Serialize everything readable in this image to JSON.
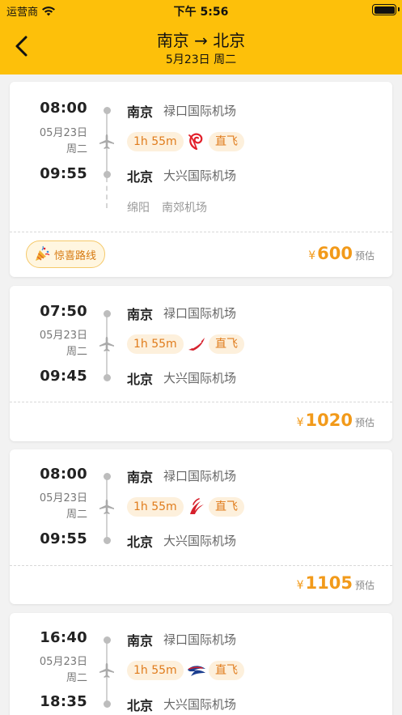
{
  "status": {
    "carrier": "运营商",
    "time": "下午 5:56"
  },
  "header": {
    "title": "南京 → 北京",
    "subtitle": "5月23日 周二"
  },
  "colors": {
    "brand": "#fdc00a",
    "accent": "#f29a1a",
    "chip_bg": "#fdf0dc"
  },
  "icons": [
    "wifi-icon",
    "battery-icon",
    "back-arrow-icon",
    "plane-icon",
    "airline-logo-icon",
    "party-popper-icon"
  ],
  "flights": [
    {
      "dep_time": "08:00",
      "date": "05月23日",
      "weekday": "周二",
      "arr_time": "09:55",
      "dep_city": "南京",
      "dep_airport": "禄口国际机场",
      "arr_city": "北京",
      "arr_airport": "大兴国际机场",
      "duration": "1h 55m",
      "airline_logo": "air-china",
      "direct": "直飞",
      "stop_city": "绵阳",
      "stop_airport": "南郊机场",
      "promo": "惊喜路线",
      "yen": "¥",
      "price": "600",
      "est": "预估"
    },
    {
      "dep_time": "07:50",
      "date": "05月23日",
      "weekday": "周二",
      "arr_time": "09:45",
      "dep_city": "南京",
      "dep_airport": "禄口国际机场",
      "arr_city": "北京",
      "arr_airport": "大兴国际机场",
      "duration": "1h 55m",
      "airline_logo": "sichuan-airlines",
      "direct": "直飞",
      "yen": "¥",
      "price": "1020",
      "est": "预估"
    },
    {
      "dep_time": "08:00",
      "date": "05月23日",
      "weekday": "周二",
      "arr_time": "09:55",
      "dep_city": "南京",
      "dep_airport": "禄口国际机场",
      "arr_city": "北京",
      "arr_airport": "大兴国际机场",
      "duration": "1h 55m",
      "airline_logo": "china-southern",
      "direct": "直飞",
      "yen": "¥",
      "price": "1105",
      "est": "预估"
    },
    {
      "dep_time": "16:40",
      "date": "05月23日",
      "weekday": "周二",
      "arr_time": "18:35",
      "dep_city": "南京",
      "dep_airport": "禄口国际机场",
      "arr_city": "北京",
      "arr_airport": "大兴国际机场",
      "duration": "1h 55m",
      "airline_logo": "china-eastern",
      "direct": "直飞"
    }
  ]
}
